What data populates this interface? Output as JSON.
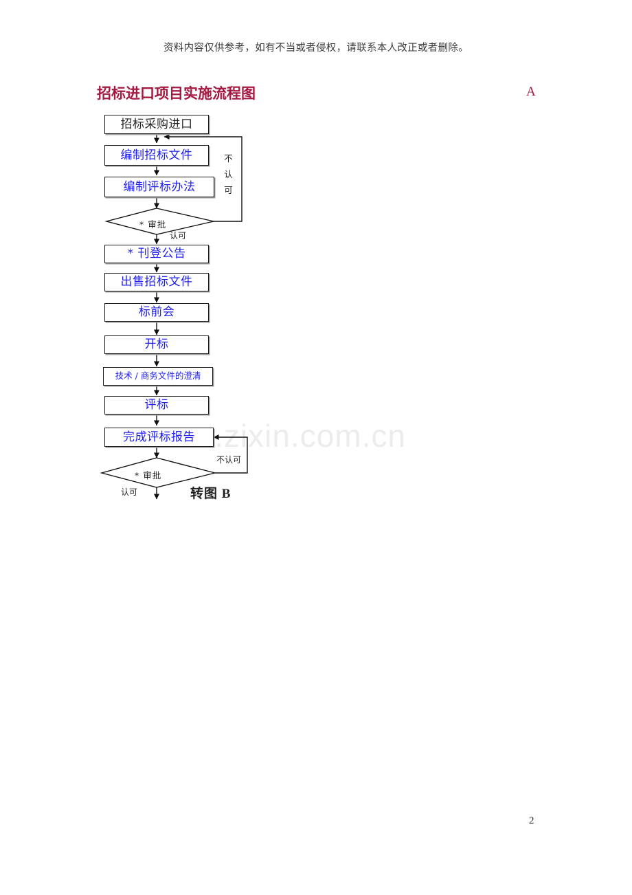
{
  "document": {
    "disclaimer": "资料内容仅供参考，如有不当或者侵权，请联系本人改正或者删除。",
    "title": "招标进口项目实施流程图",
    "title_marker": "A",
    "watermark": "www.zixin.com.cn",
    "page_number": "2",
    "title_color": "#a3193f",
    "node_text_color_primary": "#2020e8",
    "node_text_color_secondary": "#262626"
  },
  "flowchart": {
    "nodes": [
      {
        "id": "start",
        "label": "招标采购进口",
        "type": "process",
        "text_style": "black"
      },
      {
        "id": "prep_docs",
        "label": "编制招标文件",
        "type": "process",
        "text_style": "blue"
      },
      {
        "id": "prep_method",
        "label": "编制评标办法",
        "type": "process",
        "text_style": "blue"
      },
      {
        "id": "approve1",
        "label": "* 审批",
        "type": "decision"
      },
      {
        "id": "publish",
        "label": "* 刊登公告",
        "type": "process",
        "text_style": "blue"
      },
      {
        "id": "sell_docs",
        "label": "出售招标文件",
        "type": "process",
        "text_style": "blue"
      },
      {
        "id": "pre_bid",
        "label": "标前会",
        "type": "process",
        "text_style": "blue"
      },
      {
        "id": "open_bid",
        "label": "开标",
        "type": "process",
        "text_style": "blue"
      },
      {
        "id": "clarify",
        "label": "技术 / 商务文件的澄清",
        "type": "process",
        "text_style": "blue-small"
      },
      {
        "id": "evaluate",
        "label": "评标",
        "type": "process",
        "text_style": "blue"
      },
      {
        "id": "report",
        "label": "完成评标报告",
        "type": "process",
        "text_style": "blue"
      },
      {
        "id": "approve2",
        "label": "* 审批",
        "type": "decision"
      }
    ],
    "edge_labels": {
      "reject_top": "不认可",
      "approve_top": "认可",
      "reject_bottom": "不认可",
      "approve_bottom": "认可",
      "goto_next": "转图 B"
    }
  }
}
